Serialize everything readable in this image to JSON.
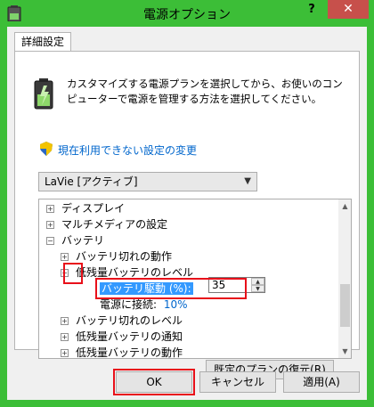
{
  "window": {
    "title": "電源オプション",
    "help_label": "?",
    "close_label": "✕"
  },
  "tab": {
    "label": "詳細設定"
  },
  "description": "カスタマイズする電源プランを選択してから、お使いのコンピューターで電源を管理する方法を選択してください。",
  "change_link": "現在利用できない設定の変更",
  "plan_select": {
    "value": "LaVie [アクティブ]"
  },
  "tree": {
    "display": "ディスプレイ",
    "multimedia": "マルチメディアの設定",
    "battery": "バッテリ",
    "battery_empty_action": "バッテリ切れの動作",
    "low_battery_level": "低残量バッテリのレベル",
    "on_battery_label": "バッテリ駆動 (%):",
    "on_battery_value": "35",
    "plugged_in_label": "電源に接続:",
    "plugged_in_value": "10%",
    "battery_empty_level": "バッテリ切れのレベル",
    "low_battery_notify": "低残量バッテリの通知",
    "low_battery_action": "低残量バッテリの動作"
  },
  "buttons": {
    "restore": "既定のプランの復元(R)",
    "ok": "OK",
    "cancel": "キャンセル",
    "apply": "適用(A)"
  },
  "colors": {
    "accent": "#3cbe37",
    "highlight": "#3399ff",
    "callout": "#e8101a",
    "link": "#0066cc"
  }
}
